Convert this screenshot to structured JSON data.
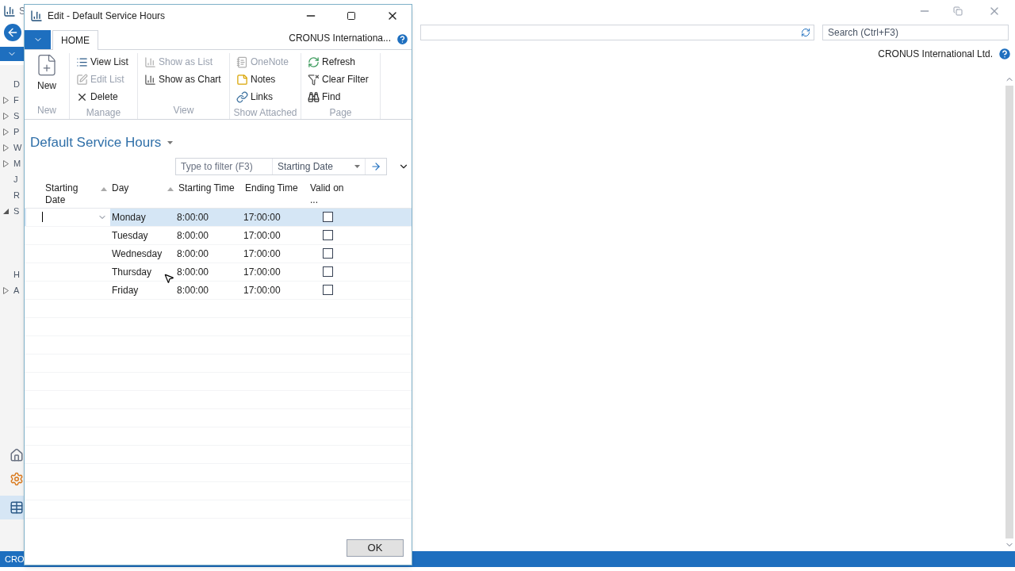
{
  "app": {
    "title_fragment": "S",
    "search": {
      "placeholder": "Search (Ctrl+F3)"
    },
    "company": "CRONUS International Ltd.",
    "status_fragment": "CRO",
    "nav_items": [
      {
        "label": "D",
        "kind": "leaf"
      },
      {
        "label": "F",
        "kind": "collapsed"
      },
      {
        "label": "S",
        "kind": "collapsed"
      },
      {
        "label": "P",
        "kind": "collapsed"
      },
      {
        "label": "W",
        "kind": "collapsed"
      },
      {
        "label": "M",
        "kind": "collapsed"
      },
      {
        "label": "J",
        "kind": "leaf"
      },
      {
        "label": "R",
        "kind": "leaf"
      },
      {
        "label": "S",
        "kind": "expanded"
      },
      {
        "label": "H",
        "kind": "gap"
      },
      {
        "label": "A",
        "kind": "collapsed"
      }
    ]
  },
  "dialog": {
    "title": "Edit - Default Service Hours",
    "tab": "HOME",
    "company": "CRONUS Internationa...",
    "ribbon_groups": [
      {
        "label": "New",
        "items": [
          {
            "label": "New",
            "disabled": false
          }
        ]
      },
      {
        "label": "Manage",
        "items": [
          {
            "label": "View List",
            "disabled": false
          },
          {
            "label": "Edit List",
            "disabled": true
          },
          {
            "label": "Delete",
            "disabled": false
          }
        ]
      },
      {
        "label": "View",
        "items": [
          {
            "label": "Show as List",
            "disabled": true
          },
          {
            "label": "Show as Chart",
            "disabled": false
          }
        ]
      },
      {
        "label": "Show Attached",
        "items": [
          {
            "label": "OneNote",
            "disabled": true
          },
          {
            "label": "Notes",
            "disabled": false
          },
          {
            "label": "Links",
            "disabled": false
          }
        ]
      },
      {
        "label": "Page",
        "items": [
          {
            "label": "Refresh",
            "disabled": false
          },
          {
            "label": "Clear Filter",
            "disabled": false
          },
          {
            "label": "Find",
            "disabled": false
          }
        ]
      }
    ],
    "page_title": "Default Service Hours",
    "filter": {
      "placeholder": "Type to filter (F3)",
      "field": "Starting Date"
    },
    "columns": [
      {
        "label": "Starting Date",
        "sorted": true
      },
      {
        "label": "Day",
        "sorted": true
      },
      {
        "label": "Starting Time",
        "sorted": false
      },
      {
        "label": "Ending Time",
        "sorted": false
      },
      {
        "label": "Valid on ...",
        "sorted": false
      }
    ],
    "rows": [
      {
        "day": "Monday",
        "start": "8:00:00",
        "end": "17:00:00",
        "valid": false,
        "selected": true
      },
      {
        "day": "Tuesday",
        "start": "8:00:00",
        "end": "17:00:00",
        "valid": false,
        "selected": false
      },
      {
        "day": "Wednesday",
        "start": "8:00:00",
        "end": "17:00:00",
        "valid": false,
        "selected": false
      },
      {
        "day": "Thursday",
        "start": "8:00:00",
        "end": "17:00:00",
        "valid": false,
        "selected": false
      },
      {
        "day": "Friday",
        "start": "8:00:00",
        "end": "17:00:00",
        "valid": false,
        "selected": false
      }
    ],
    "ok": "OK"
  }
}
